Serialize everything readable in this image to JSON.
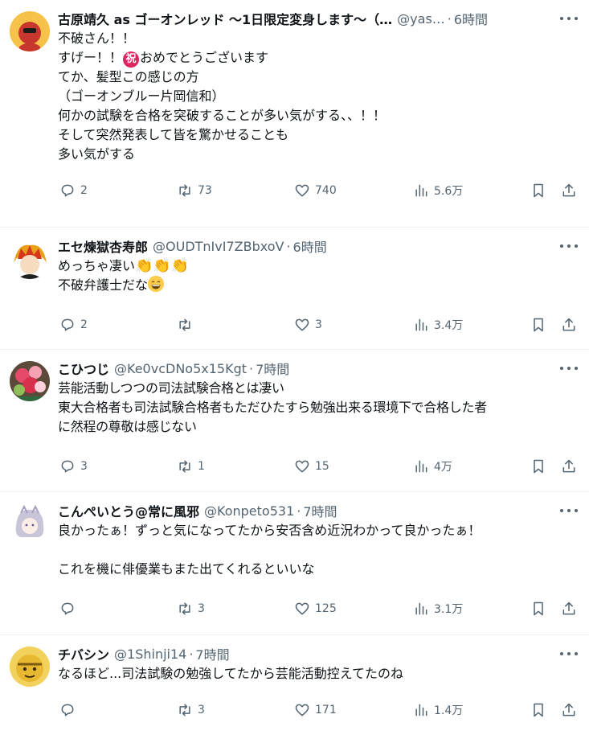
{
  "posts": [
    {
      "name": "古原靖久 as ゴーオンレッド ～1日限定変身します～（…",
      "handle": "@yas…",
      "time": "6時間",
      "avatar": "avatar-red-hero",
      "lines": [
        "不破さん！！",
        "すげー！！",
        "おめでとうございます",
        "てか、髪型この感じの方",
        "（ゴーオンブルー片岡信和）",
        "何かの試験を合格を突破することが多い気がする、、！！",
        "そして突然発表して皆を驚かせることも",
        "多い気がする"
      ],
      "emoji_iwai": "祝",
      "replies": "2",
      "reposts": "73",
      "likes": "740",
      "views": "5.6万"
    },
    {
      "name": "エセ煉獄杏寿郎",
      "handle": "@OUDTnIvI7ZBbxoV",
      "time": "6時間",
      "avatar": "avatar-flame-hair",
      "lines": [
        "めっちゃ凄い",
        "不破弁護士だな"
      ],
      "clap_emoji": "👏👏👏",
      "replies": "2",
      "reposts": "",
      "likes": "3",
      "views": "3.4万"
    },
    {
      "name": "こひつじ",
      "handle": "@Ke0vcDNo5x15Kgt",
      "time": "7時間",
      "avatar": "avatar-flowers",
      "lines": [
        "芸能活動しつつの司法試験合格とは凄い",
        "東大合格者も司法試験合格者もただひたすら勉強出来る環境下で合格した者",
        "に然程の尊敬は感じない"
      ],
      "replies": "3",
      "reposts": "1",
      "likes": "15",
      "views": "4万"
    },
    {
      "name": "こんぺいとう@常に風邪",
      "handle": "@Konpeto531",
      "time": "7時間",
      "avatar": "avatar-anime-girl",
      "lines": [
        "良かったぁ！ずっと気になってたから安否含め近況わかって良かったぁ！",
        "",
        "これを機に俳優業もまた出てくれるといいな"
      ],
      "replies": "",
      "reposts": "3",
      "likes": "125",
      "views": "3.1万"
    },
    {
      "name": "チバシン",
      "handle": "@1Shinji14",
      "time": "7時間",
      "avatar": "avatar-yellow-mask",
      "lines": [
        "なるほど...司法試験の勉強してたから芸能活動控えてたのね"
      ],
      "replies": "",
      "reposts": "3",
      "likes": "171",
      "views": "1.4万"
    }
  ],
  "colors": {
    "text": "#0f1419",
    "muted": "#536471",
    "border": "#eff3f4",
    "iwai": "#e0245e"
  }
}
